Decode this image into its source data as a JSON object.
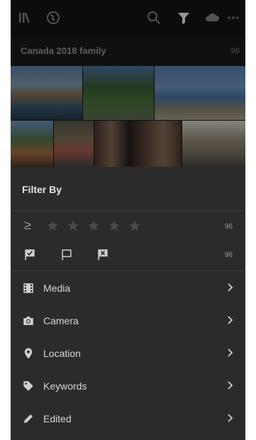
{
  "album": {
    "title": "Canada 2018 family",
    "count": "96"
  },
  "filter": {
    "title": "Filter By",
    "rating": {
      "operator": "≥",
      "stars": 5,
      "count": "96"
    },
    "flags": {
      "count": "96"
    },
    "items": [
      {
        "label": "Media",
        "icon": "film-icon"
      },
      {
        "label": "Camera",
        "icon": "camera-icon"
      },
      {
        "label": "Location",
        "icon": "location-pin-icon"
      },
      {
        "label": "Keywords",
        "icon": "tag-icon"
      },
      {
        "label": "Edited",
        "icon": "pencil-icon"
      }
    ]
  },
  "colors": {
    "sheet": "#2b2b2b",
    "text": "#d6d6d6",
    "muted": "#9a9a9a",
    "divider": "#3d3d3d"
  }
}
